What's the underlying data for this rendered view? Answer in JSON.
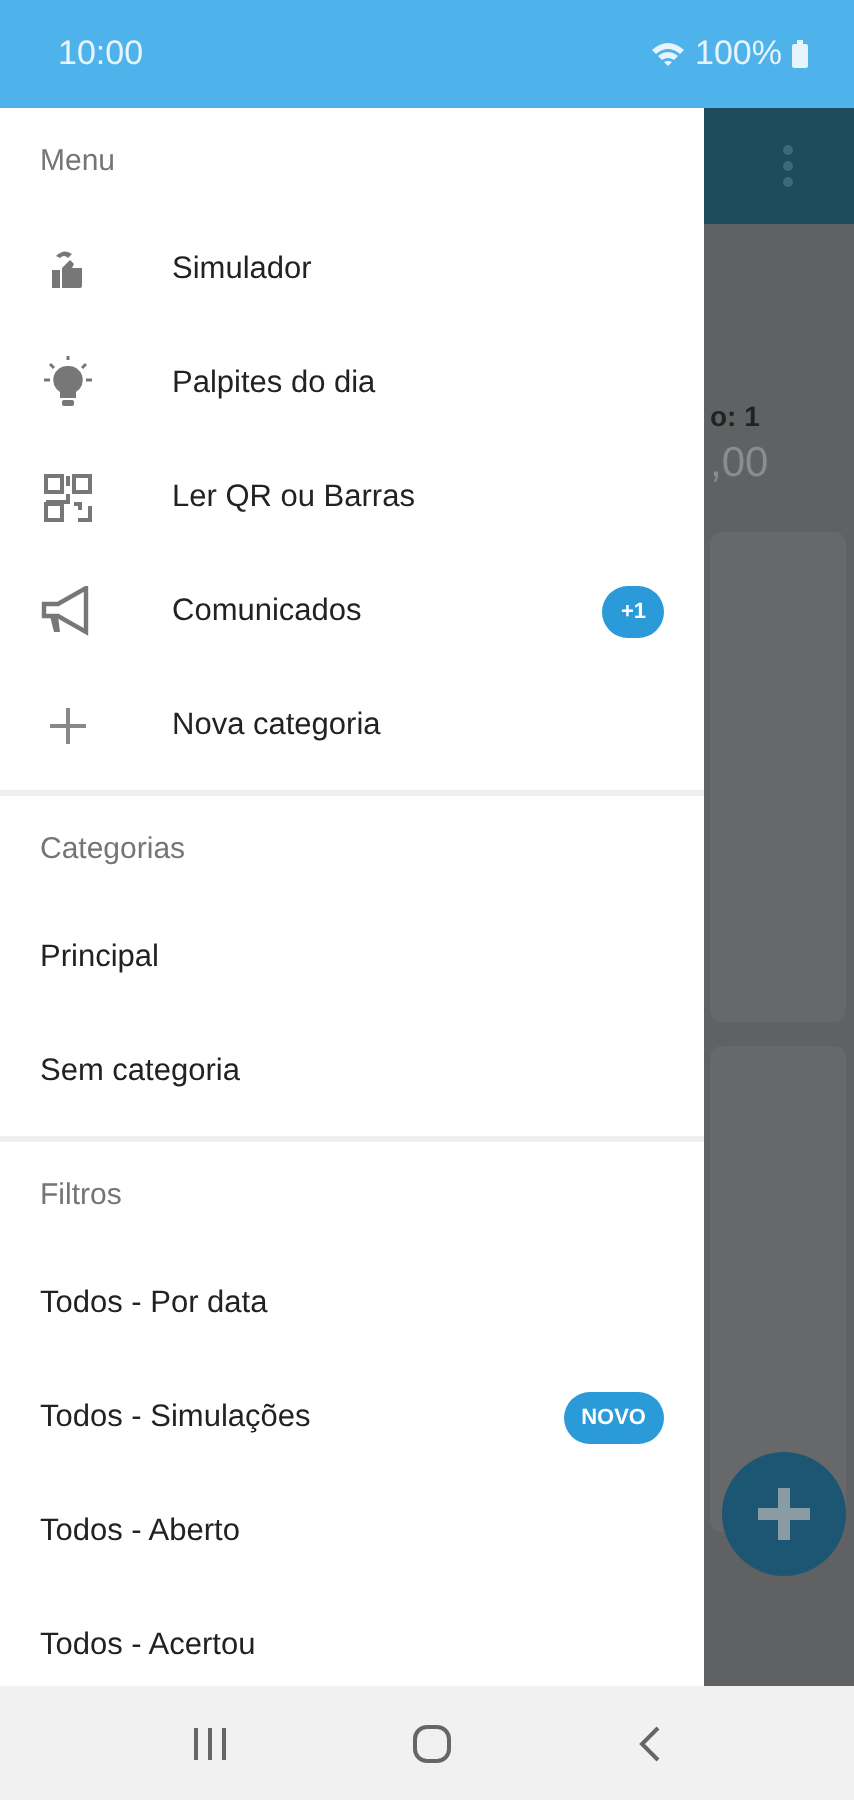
{
  "status_bar": {
    "time": "10:00",
    "battery": "100%"
  },
  "background": {
    "texts": [
      "o: 1",
      ",00"
    ]
  },
  "drawer": {
    "sections": [
      {
        "title": "Menu",
        "items": [
          {
            "label": "Simulador",
            "kind": "hand"
          },
          {
            "label": "Palpites do dia",
            "kind": "bulb"
          },
          {
            "label": "Ler QR ou Barras",
            "kind": "qr"
          },
          {
            "label": "Comunicados",
            "kind": "megaphone",
            "badge": "+1"
          },
          {
            "label": "Nova categoria",
            "kind": "plus"
          }
        ]
      },
      {
        "title": "Categorias",
        "items": [
          {
            "label": "Principal"
          },
          {
            "label": "Sem categoria"
          }
        ]
      },
      {
        "title": "Filtros",
        "items": [
          {
            "label": "Todos - Por data"
          },
          {
            "label": "Todos - Simulações",
            "badge": "NOVO"
          },
          {
            "label": "Todos - Aberto"
          },
          {
            "label": "Todos - Acertou"
          }
        ]
      }
    ]
  }
}
